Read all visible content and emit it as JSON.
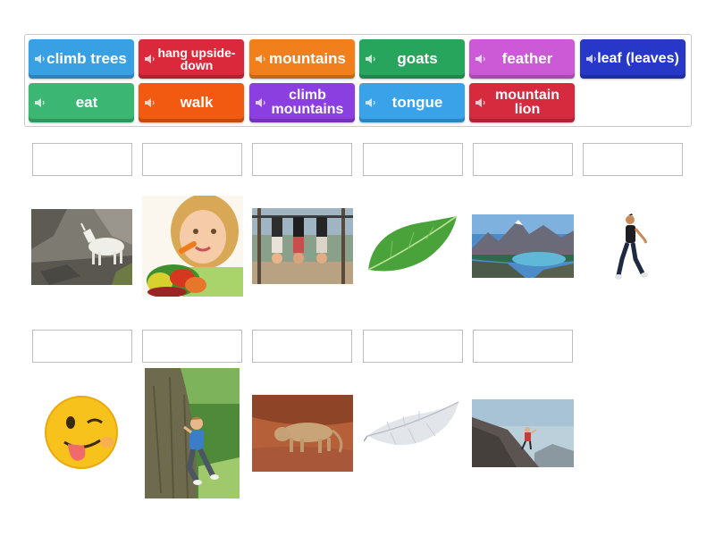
{
  "word_bank": [
    {
      "text": "climb trees",
      "color": "#3aa0e4",
      "icon": "speaker-icon"
    },
    {
      "text": "hang upside-down",
      "color": "#d9293a",
      "icon": "speaker-icon"
    },
    {
      "text": "mountains",
      "color": "#f07f1c",
      "icon": "speaker-icon"
    },
    {
      "text": "goats",
      "color": "#27a55d",
      "icon": "speaker-icon"
    },
    {
      "text": "feather",
      "color": "#cc5ad6",
      "icon": "speaker-icon"
    },
    {
      "text": "leaf (leaves)",
      "color": "#2738c8",
      "icon": "speaker-icon"
    },
    {
      "text": "eat",
      "color": "#3cb673",
      "icon": "speaker-icon"
    },
    {
      "text": "walk",
      "color": "#f25a12",
      "icon": "speaker-icon"
    },
    {
      "text": "climb mountains",
      "color": "#8b3fe0",
      "icon": "speaker-icon"
    },
    {
      "text": "tongue",
      "color": "#39a2e8",
      "icon": "speaker-icon"
    },
    {
      "text": "mountain lion",
      "color": "#d62a3f",
      "icon": "speaker-icon"
    }
  ],
  "answer_slots": {
    "row1": [
      "",
      "",
      "",
      "",
      "",
      ""
    ],
    "row2": [
      "",
      "",
      "",
      "",
      ""
    ]
  },
  "pictures": {
    "row1": [
      "goat-on-rocks-image",
      "girl-eating-vegetables-image",
      "kids-hanging-upside-down-image",
      "green-leaf-image",
      "mountain-lake-image",
      "person-walking-image"
    ],
    "row2": [
      "winking-tongue-emoji-image",
      "boy-climbing-tree-image",
      "mountain-lion-image",
      "white-feather-image",
      "climber-on-mountain-image"
    ]
  }
}
